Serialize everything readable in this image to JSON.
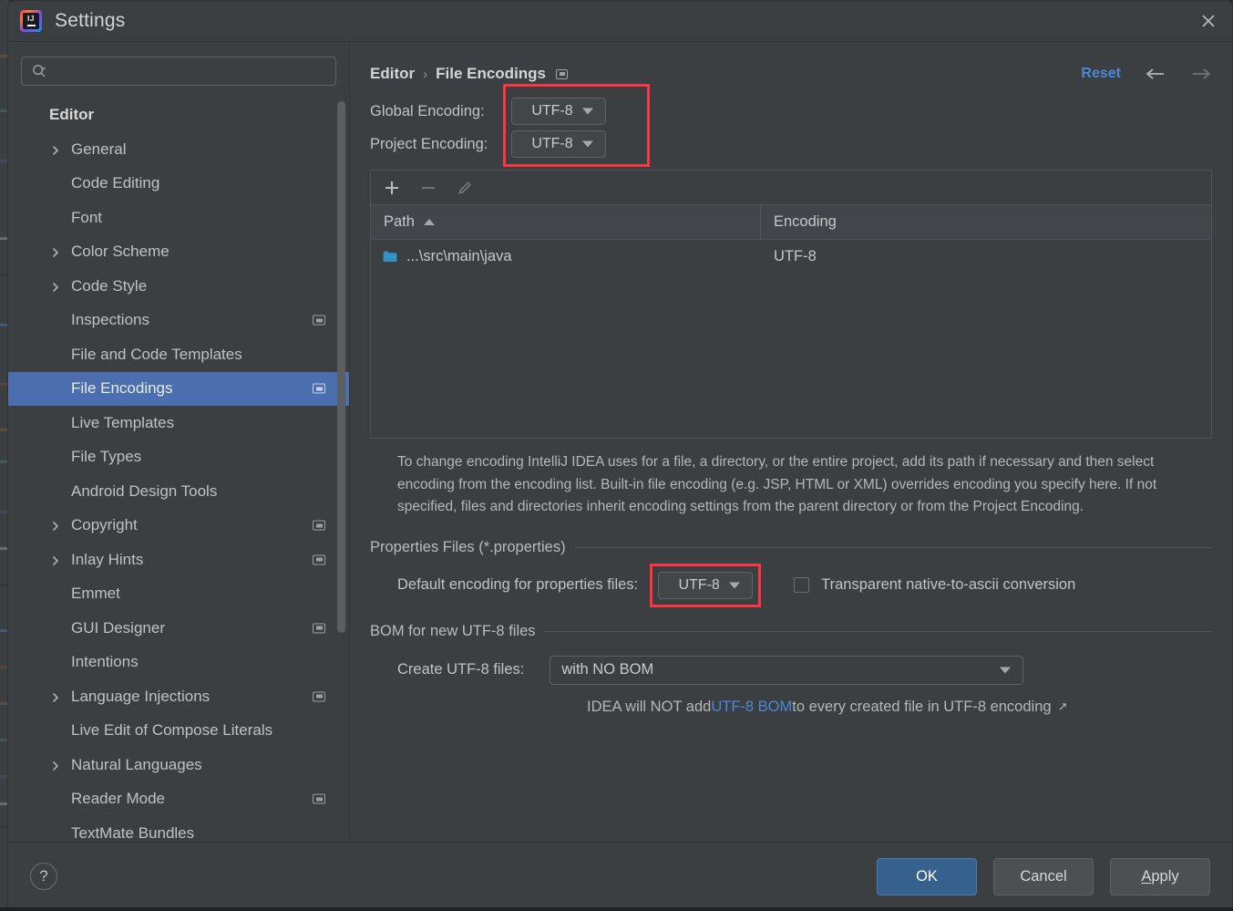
{
  "window": {
    "title": "Settings",
    "app_icon": "intellij-idea-logo",
    "close_icon": "close-icon"
  },
  "search": {
    "placeholder": "",
    "value": "",
    "icon": "search-icon"
  },
  "sidebar": {
    "header": "Editor",
    "items": [
      {
        "label": "General",
        "expandable": true,
        "badge": false,
        "selected": false
      },
      {
        "label": "Code Editing",
        "expandable": false,
        "badge": false,
        "selected": false
      },
      {
        "label": "Font",
        "expandable": false,
        "badge": false,
        "selected": false
      },
      {
        "label": "Color Scheme",
        "expandable": true,
        "badge": false,
        "selected": false
      },
      {
        "label": "Code Style",
        "expandable": true,
        "badge": false,
        "selected": false
      },
      {
        "label": "Inspections",
        "expandable": false,
        "badge": true,
        "selected": false
      },
      {
        "label": "File and Code Templates",
        "expandable": false,
        "badge": false,
        "selected": false
      },
      {
        "label": "File Encodings",
        "expandable": false,
        "badge": true,
        "selected": true
      },
      {
        "label": "Live Templates",
        "expandable": false,
        "badge": false,
        "selected": false
      },
      {
        "label": "File Types",
        "expandable": false,
        "badge": false,
        "selected": false
      },
      {
        "label": "Android Design Tools",
        "expandable": false,
        "badge": false,
        "selected": false
      },
      {
        "label": "Copyright",
        "expandable": true,
        "badge": true,
        "selected": false
      },
      {
        "label": "Inlay Hints",
        "expandable": true,
        "badge": true,
        "selected": false
      },
      {
        "label": "Emmet",
        "expandable": false,
        "badge": false,
        "selected": false
      },
      {
        "label": "GUI Designer",
        "expandable": false,
        "badge": true,
        "selected": false
      },
      {
        "label": "Intentions",
        "expandable": false,
        "badge": false,
        "selected": false
      },
      {
        "label": "Language Injections",
        "expandable": true,
        "badge": true,
        "selected": false
      },
      {
        "label": "Live Edit of Compose Literals",
        "expandable": false,
        "badge": false,
        "selected": false
      },
      {
        "label": "Natural Languages",
        "expandable": true,
        "badge": false,
        "selected": false
      },
      {
        "label": "Reader Mode",
        "expandable": false,
        "badge": true,
        "selected": false
      },
      {
        "label": "TextMate Bundles",
        "expandable": false,
        "badge": false,
        "selected": false
      }
    ]
  },
  "breadcrumb": {
    "parent": "Editor",
    "separator": "›",
    "current": "File Encodings"
  },
  "header_actions": {
    "reset_label": "Reset",
    "back_icon": "arrow-left-icon",
    "forward_icon": "arrow-right-icon"
  },
  "encodings": {
    "global_label": "Global Encoding:",
    "global_value": "UTF-8",
    "project_label": "Project Encoding:",
    "project_value": "UTF-8"
  },
  "table": {
    "toolbar": {
      "add_icon": "plus-icon",
      "remove_icon": "minus-icon",
      "edit_icon": "pencil-icon"
    },
    "columns": [
      "Path",
      "Encoding"
    ],
    "sort_column": "Path",
    "sort_direction": "ascending",
    "rows": [
      {
        "path": "...\\src\\main\\java",
        "encoding": "UTF-8",
        "icon": "folder-icon"
      }
    ]
  },
  "description": "To change encoding IntelliJ IDEA uses for a file, a directory, or the entire project, add its path if necessary and then select encoding from the encoding list. Built-in file encoding (e.g. JSP, HTML or XML) overrides encoding you specify here. If not specified, files and directories inherit encoding settings from the parent directory or from the Project Encoding.",
  "properties_section": {
    "title": "Properties Files (*.properties)",
    "default_encoding_label": "Default encoding for properties files:",
    "default_encoding_value": "UTF-8",
    "transparent_label": "Transparent native-to-ascii conversion",
    "transparent_checked": false
  },
  "bom_section": {
    "title": "BOM for new UTF-8 files",
    "create_label": "Create UTF-8 files:",
    "create_value": "with NO BOM",
    "note_prefix": "IDEA will NOT add ",
    "note_link": "UTF-8 BOM",
    "note_suffix": " to every created file in UTF-8 encoding",
    "note_external_icon": "↗"
  },
  "footer": {
    "help_label": "?",
    "ok_label": "OK",
    "cancel_label": "Cancel",
    "apply_label_prefix": "A",
    "apply_label_rest": "pply"
  },
  "annotations": {
    "encoding_box": "red-highlight-rectangle",
    "properties_box": "red-highlight-rectangle",
    "color": "#fb3640"
  },
  "colors": {
    "accent_blue": "#4a88d8",
    "selection_blue": "#4b6eaf",
    "primary_button": "#36618f",
    "panel_bg": "#3c3f41",
    "folder_icon": "#3592c4",
    "annotation_red": "#fb3640"
  }
}
